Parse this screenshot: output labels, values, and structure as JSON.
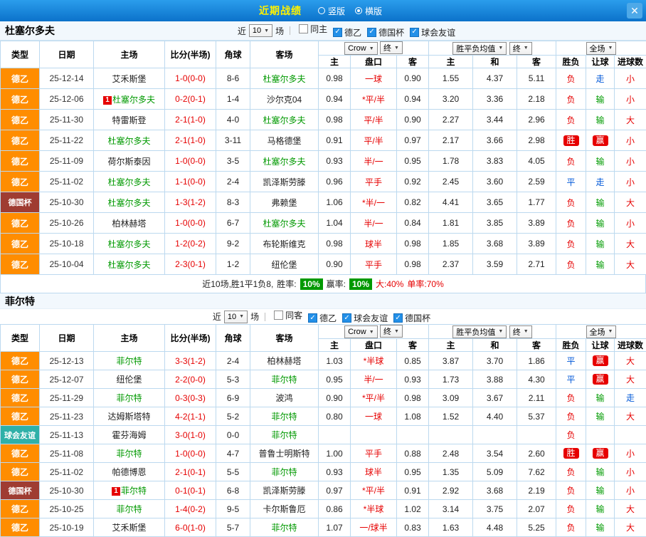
{
  "icons": {
    "chevron_down": "▼",
    "close": "✕",
    "check": "✓",
    "radio": "radio"
  },
  "header": {
    "title": "近期战绩",
    "layout_options": [
      {
        "label": "竖版",
        "selected": false
      },
      {
        "label": "横版",
        "selected": true
      }
    ]
  },
  "dropdowns": {
    "bookmaker": "Crow",
    "final": "终",
    "avg": "胜平负均值",
    "full": "全场"
  },
  "columns": {
    "type": "类型",
    "date": "日期",
    "home": "主场",
    "score": "比分(半场)",
    "corner": "角球",
    "away": "客场",
    "odds_home": "主",
    "handicap": "盘口",
    "odds_away": "客",
    "avg_home": "主",
    "avg_draw": "和",
    "avg_away": "客",
    "result": "胜负",
    "let": "让球",
    "goals": "进球数"
  },
  "sections": [
    {
      "team": "杜塞尔多夫",
      "filter": {
        "near": "近",
        "count": "10",
        "games": "场",
        "options": [
          {
            "label": "同主",
            "checked": false
          },
          {
            "label": "德乙",
            "checked": true
          },
          {
            "label": "德国杯",
            "checked": true
          },
          {
            "label": "球会友谊",
            "checked": true
          }
        ]
      },
      "rows": [
        {
          "type": "德乙",
          "tc": "l2",
          "date": "25-12-14",
          "home": "艾禾斯堡",
          "hf": false,
          "hb": "",
          "score": "1-0(0-0)",
          "corner": "8-6",
          "away": "杜塞尔多夫",
          "af": true,
          "ab": "",
          "o1": "0.98",
          "hcp": "一球",
          "o2": "0.90",
          "m1": "1.55",
          "m2": "4.37",
          "m3": "5.11",
          "res": "负",
          "res_s": "lose",
          "let": "走",
          "let_s": "push",
          "goal": "小",
          "goal_s": "small"
        },
        {
          "type": "德乙",
          "tc": "l2",
          "date": "25-12-06",
          "home": "杜塞尔多夫",
          "hf": true,
          "hb": "1",
          "score": "0-2(0-1)",
          "corner": "1-4",
          "away": "沙尔克04",
          "af": false,
          "ab": "",
          "o1": "0.94",
          "hcp": "*平/半",
          "o2": "0.94",
          "m1": "3.20",
          "m2": "3.36",
          "m3": "2.18",
          "res": "负",
          "res_s": "lose",
          "let": "输",
          "let_s": "lose",
          "goal": "小",
          "goal_s": "small"
        },
        {
          "type": "德乙",
          "tc": "l2",
          "date": "25-11-30",
          "home": "特雷斯登",
          "hf": false,
          "hb": "",
          "score": "2-1(1-0)",
          "corner": "4-0",
          "away": "杜塞尔多夫",
          "af": true,
          "ab": "",
          "o1": "0.98",
          "hcp": "平/半",
          "o2": "0.90",
          "m1": "2.27",
          "m2": "3.44",
          "m3": "2.96",
          "res": "负",
          "res_s": "lose",
          "let": "输",
          "let_s": "lose",
          "goal": "大",
          "goal_s": "big"
        },
        {
          "type": "德乙",
          "tc": "l2",
          "date": "25-11-22",
          "home": "杜塞尔多夫",
          "hf": true,
          "hb": "",
          "score": "2-1(1-0)",
          "corner": "3-11",
          "away": "马格德堡",
          "af": false,
          "ab": "",
          "o1": "0.91",
          "hcp": "平/半",
          "o2": "0.97",
          "m1": "2.17",
          "m2": "3.66",
          "m3": "2.98",
          "res": "胜",
          "res_s": "win",
          "let": "赢",
          "let_s": "win",
          "goal": "小",
          "goal_s": "small"
        },
        {
          "type": "德乙",
          "tc": "l2",
          "date": "25-11-09",
          "home": "荷尔斯泰因",
          "hf": false,
          "hb": "",
          "score": "1-0(0-0)",
          "corner": "3-5",
          "away": "杜塞尔多夫",
          "af": true,
          "ab": "",
          "o1": "0.93",
          "hcp": "半/一",
          "o2": "0.95",
          "m1": "1.78",
          "m2": "3.83",
          "m3": "4.05",
          "res": "负",
          "res_s": "lose",
          "let": "输",
          "let_s": "lose",
          "goal": "小",
          "goal_s": "small"
        },
        {
          "type": "德乙",
          "tc": "l2",
          "date": "25-11-02",
          "home": "杜塞尔多夫",
          "hf": true,
          "hb": "",
          "score": "1-1(0-0)",
          "corner": "2-4",
          "away": "凯泽斯劳滕",
          "af": false,
          "ab": "",
          "o1": "0.96",
          "hcp": "平手",
          "o2": "0.92",
          "m1": "2.45",
          "m2": "3.60",
          "m3": "2.59",
          "res": "平",
          "res_s": "draw",
          "let": "走",
          "let_s": "push",
          "goal": "小",
          "goal_s": "small"
        },
        {
          "type": "德国杯",
          "tc": "cup",
          "date": "25-10-30",
          "home": "杜塞尔多夫",
          "hf": true,
          "hb": "",
          "score": "1-3(1-2)",
          "corner": "8-3",
          "away": "弗赖堡",
          "af": false,
          "ab": "",
          "o1": "1.06",
          "hcp": "*半/一",
          "o2": "0.82",
          "m1": "4.41",
          "m2": "3.65",
          "m3": "1.77",
          "res": "负",
          "res_s": "lose",
          "let": "输",
          "let_s": "lose",
          "goal": "大",
          "goal_s": "big"
        },
        {
          "type": "德乙",
          "tc": "l2",
          "date": "25-10-26",
          "home": "柏林赫塔",
          "hf": false,
          "hb": "",
          "score": "1-0(0-0)",
          "corner": "6-7",
          "away": "杜塞尔多夫",
          "af": true,
          "ab": "",
          "o1": "1.04",
          "hcp": "半/一",
          "o2": "0.84",
          "m1": "1.81",
          "m2": "3.85",
          "m3": "3.89",
          "res": "负",
          "res_s": "lose",
          "let": "输",
          "let_s": "lose",
          "goal": "小",
          "goal_s": "small"
        },
        {
          "type": "德乙",
          "tc": "l2",
          "date": "25-10-18",
          "home": "杜塞尔多夫",
          "hf": true,
          "hb": "",
          "score": "1-2(0-2)",
          "corner": "9-2",
          "away": "布轮斯维克",
          "af": false,
          "ab": "",
          "o1": "0.98",
          "hcp": "球半",
          "o2": "0.98",
          "m1": "1.85",
          "m2": "3.68",
          "m3": "3.89",
          "res": "负",
          "res_s": "lose",
          "let": "输",
          "let_s": "lose",
          "goal": "大",
          "goal_s": "big"
        },
        {
          "type": "德乙",
          "tc": "l2",
          "date": "25-10-04",
          "home": "杜塞尔多夫",
          "hf": true,
          "hb": "",
          "score": "2-3(0-1)",
          "corner": "1-2",
          "away": "纽伦堡",
          "af": false,
          "ab": "",
          "o1": "0.90",
          "hcp": "平手",
          "o2": "0.98",
          "m1": "2.37",
          "m2": "3.59",
          "m3": "2.71",
          "res": "负",
          "res_s": "lose",
          "let": "输",
          "let_s": "lose",
          "goal": "大",
          "goal_s": "big"
        }
      ],
      "summary": {
        "record": "近10场,胜1平1负8,",
        "win_rate_label": "胜率:",
        "win_rate": "10%",
        "cover_rate_label": "赢率:",
        "cover_rate": "10%",
        "big_rate": "大:40%",
        "single_rate": "单率:70%"
      }
    },
    {
      "team": "菲尔特",
      "filter": {
        "near": "近",
        "count": "10",
        "games": "场",
        "options": [
          {
            "label": "同客",
            "checked": false
          },
          {
            "label": "德乙",
            "checked": true
          },
          {
            "label": "球会友谊",
            "checked": true
          },
          {
            "label": "德国杯",
            "checked": true
          }
        ]
      },
      "rows": [
        {
          "type": "德乙",
          "tc": "l2",
          "date": "25-12-13",
          "home": "菲尔特",
          "hf": true,
          "hb": "",
          "score": "3-3(1-2)",
          "corner": "2-4",
          "away": "柏林赫塔",
          "af": false,
          "ab": "",
          "o1": "1.03",
          "hcp": "*半球",
          "o2": "0.85",
          "m1": "3.87",
          "m2": "3.70",
          "m3": "1.86",
          "res": "平",
          "res_s": "draw",
          "let": "赢",
          "let_s": "win",
          "goal": "大",
          "goal_s": "big"
        },
        {
          "type": "德乙",
          "tc": "l2",
          "date": "25-12-07",
          "home": "纽伦堡",
          "hf": false,
          "hb": "",
          "score": "2-2(0-0)",
          "corner": "5-3",
          "away": "菲尔特",
          "af": true,
          "ab": "",
          "o1": "0.95",
          "hcp": "半/一",
          "o2": "0.93",
          "m1": "1.73",
          "m2": "3.88",
          "m3": "4.30",
          "res": "平",
          "res_s": "draw",
          "let": "赢",
          "let_s": "win",
          "goal": "大",
          "goal_s": "big"
        },
        {
          "type": "德乙",
          "tc": "l2",
          "date": "25-11-29",
          "home": "菲尔特",
          "hf": true,
          "hb": "",
          "score": "0-3(0-3)",
          "corner": "6-9",
          "away": "波鸿",
          "af": false,
          "ab": "",
          "o1": "0.90",
          "hcp": "*平/半",
          "o2": "0.98",
          "m1": "3.09",
          "m2": "3.67",
          "m3": "2.11",
          "res": "负",
          "res_s": "lose",
          "let": "输",
          "let_s": "lose",
          "goal": "走",
          "goal_s": "push"
        },
        {
          "type": "德乙",
          "tc": "l2",
          "date": "25-11-23",
          "home": "达姆斯塔特",
          "hf": false,
          "hb": "",
          "score": "4-2(1-1)",
          "corner": "5-2",
          "away": "菲尔特",
          "af": true,
          "ab": "",
          "o1": "0.80",
          "hcp": "一球",
          "o2": "1.08",
          "m1": "1.52",
          "m2": "4.40",
          "m3": "5.37",
          "res": "负",
          "res_s": "lose",
          "let": "输",
          "let_s": "lose",
          "goal": "大",
          "goal_s": "big"
        },
        {
          "type": "球会友谊",
          "tc": "fr",
          "date": "25-11-13",
          "home": "霍芬海姆",
          "hf": false,
          "hb": "",
          "score": "3-0(1-0)",
          "corner": "0-0",
          "away": "菲尔特",
          "af": true,
          "ab": "",
          "o1": "",
          "hcp": "",
          "o2": "",
          "m1": "",
          "m2": "",
          "m3": "",
          "res": "负",
          "res_s": "lose",
          "let": "",
          "let_s": "",
          "goal": "",
          "goal_s": ""
        },
        {
          "type": "德乙",
          "tc": "l2",
          "date": "25-11-08",
          "home": "菲尔特",
          "hf": true,
          "hb": "",
          "score": "1-0(0-0)",
          "corner": "4-7",
          "away": "普鲁士明斯特",
          "af": false,
          "ab": "",
          "o1": "1.00",
          "hcp": "平手",
          "o2": "0.88",
          "m1": "2.48",
          "m2": "3.54",
          "m3": "2.60",
          "res": "胜",
          "res_s": "win",
          "let": "赢",
          "let_s": "win",
          "goal": "小",
          "goal_s": "small"
        },
        {
          "type": "德乙",
          "tc": "l2",
          "date": "25-11-02",
          "home": "帕德博恩",
          "hf": false,
          "hb": "",
          "score": "2-1(0-1)",
          "corner": "5-5",
          "away": "菲尔特",
          "af": true,
          "ab": "",
          "o1": "0.93",
          "hcp": "球半",
          "o2": "0.95",
          "m1": "1.35",
          "m2": "5.09",
          "m3": "7.62",
          "res": "负",
          "res_s": "lose",
          "let": "输",
          "let_s": "lose",
          "goal": "小",
          "goal_s": "small"
        },
        {
          "type": "德国杯",
          "tc": "cup",
          "date": "25-10-30",
          "home": "菲尔特",
          "hf": true,
          "hb": "1",
          "score": "0-1(0-1)",
          "corner": "6-8",
          "away": "凯泽斯劳滕",
          "af": false,
          "ab": "",
          "o1": "0.97",
          "hcp": "*平/半",
          "o2": "0.91",
          "m1": "2.92",
          "m2": "3.68",
          "m3": "2.19",
          "res": "负",
          "res_s": "lose",
          "let": "输",
          "let_s": "lose",
          "goal": "小",
          "goal_s": "small"
        },
        {
          "type": "德乙",
          "tc": "l2",
          "date": "25-10-25",
          "home": "菲尔特",
          "hf": true,
          "hb": "",
          "score": "1-4(0-2)",
          "corner": "9-5",
          "away": "卡尔斯鲁厄",
          "af": false,
          "ab": "",
          "o1": "0.86",
          "hcp": "*半球",
          "o2": "1.02",
          "m1": "3.14",
          "m2": "3.75",
          "m3": "2.07",
          "res": "负",
          "res_s": "lose",
          "let": "输",
          "let_s": "lose",
          "goal": "大",
          "goal_s": "big"
        },
        {
          "type": "德乙",
          "tc": "l2",
          "date": "25-10-19",
          "home": "艾禾斯堡",
          "hf": false,
          "hb": "",
          "score": "6-0(1-0)",
          "corner": "5-7",
          "away": "菲尔特",
          "af": true,
          "ab": "",
          "o1": "1.07",
          "hcp": "一/球半",
          "o2": "0.83",
          "m1": "1.63",
          "m2": "4.48",
          "m3": "5.25",
          "res": "负",
          "res_s": "lose",
          "let": "输",
          "let_s": "lose",
          "goal": "大",
          "goal_s": "big"
        }
      ]
    }
  ]
}
